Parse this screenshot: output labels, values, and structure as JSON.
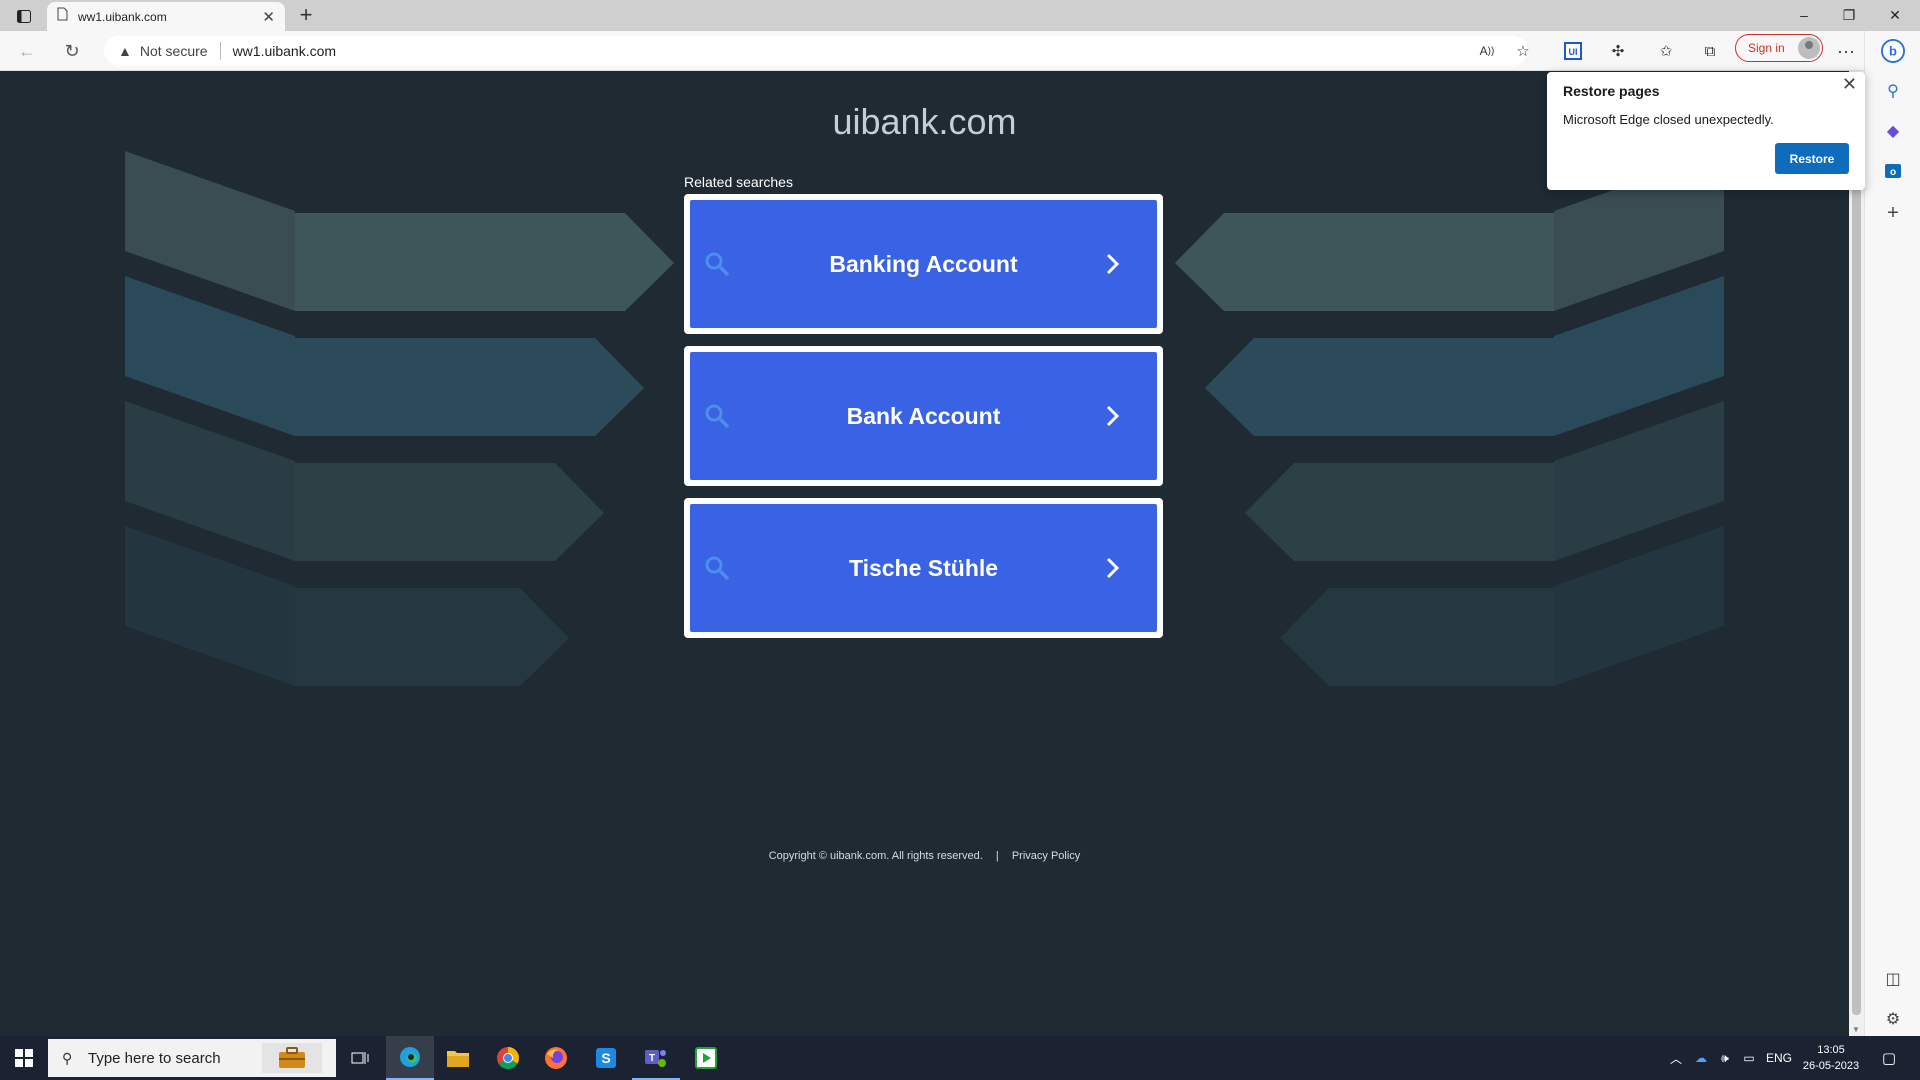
{
  "browser": {
    "tab_title": "ww1.uibank.com",
    "address": "ww1.uibank.com",
    "security_label": "Not secure",
    "signin_label": "Sign in"
  },
  "page": {
    "site_title": "uibank.com",
    "related_label": "Related searches",
    "searches": [
      {
        "label": "Banking Account"
      },
      {
        "label": "Bank Account"
      },
      {
        "label": "Tische Stühle"
      }
    ],
    "footer": {
      "copyright": "Copyright © uibank.com.  All rights reserved.",
      "separator": "|",
      "privacy": "Privacy Policy"
    },
    "colors": {
      "background": "#1f2a33",
      "card_fill": "#3a62e4",
      "card_border": "#ffffff"
    }
  },
  "restore_popup": {
    "title": "Restore pages",
    "message": "Microsoft Edge closed unexpectedly.",
    "button": "Restore"
  },
  "taskbar": {
    "search_placeholder": "Type here to search",
    "language": "ENG",
    "time": "13:05",
    "date": "26-05-2023"
  }
}
